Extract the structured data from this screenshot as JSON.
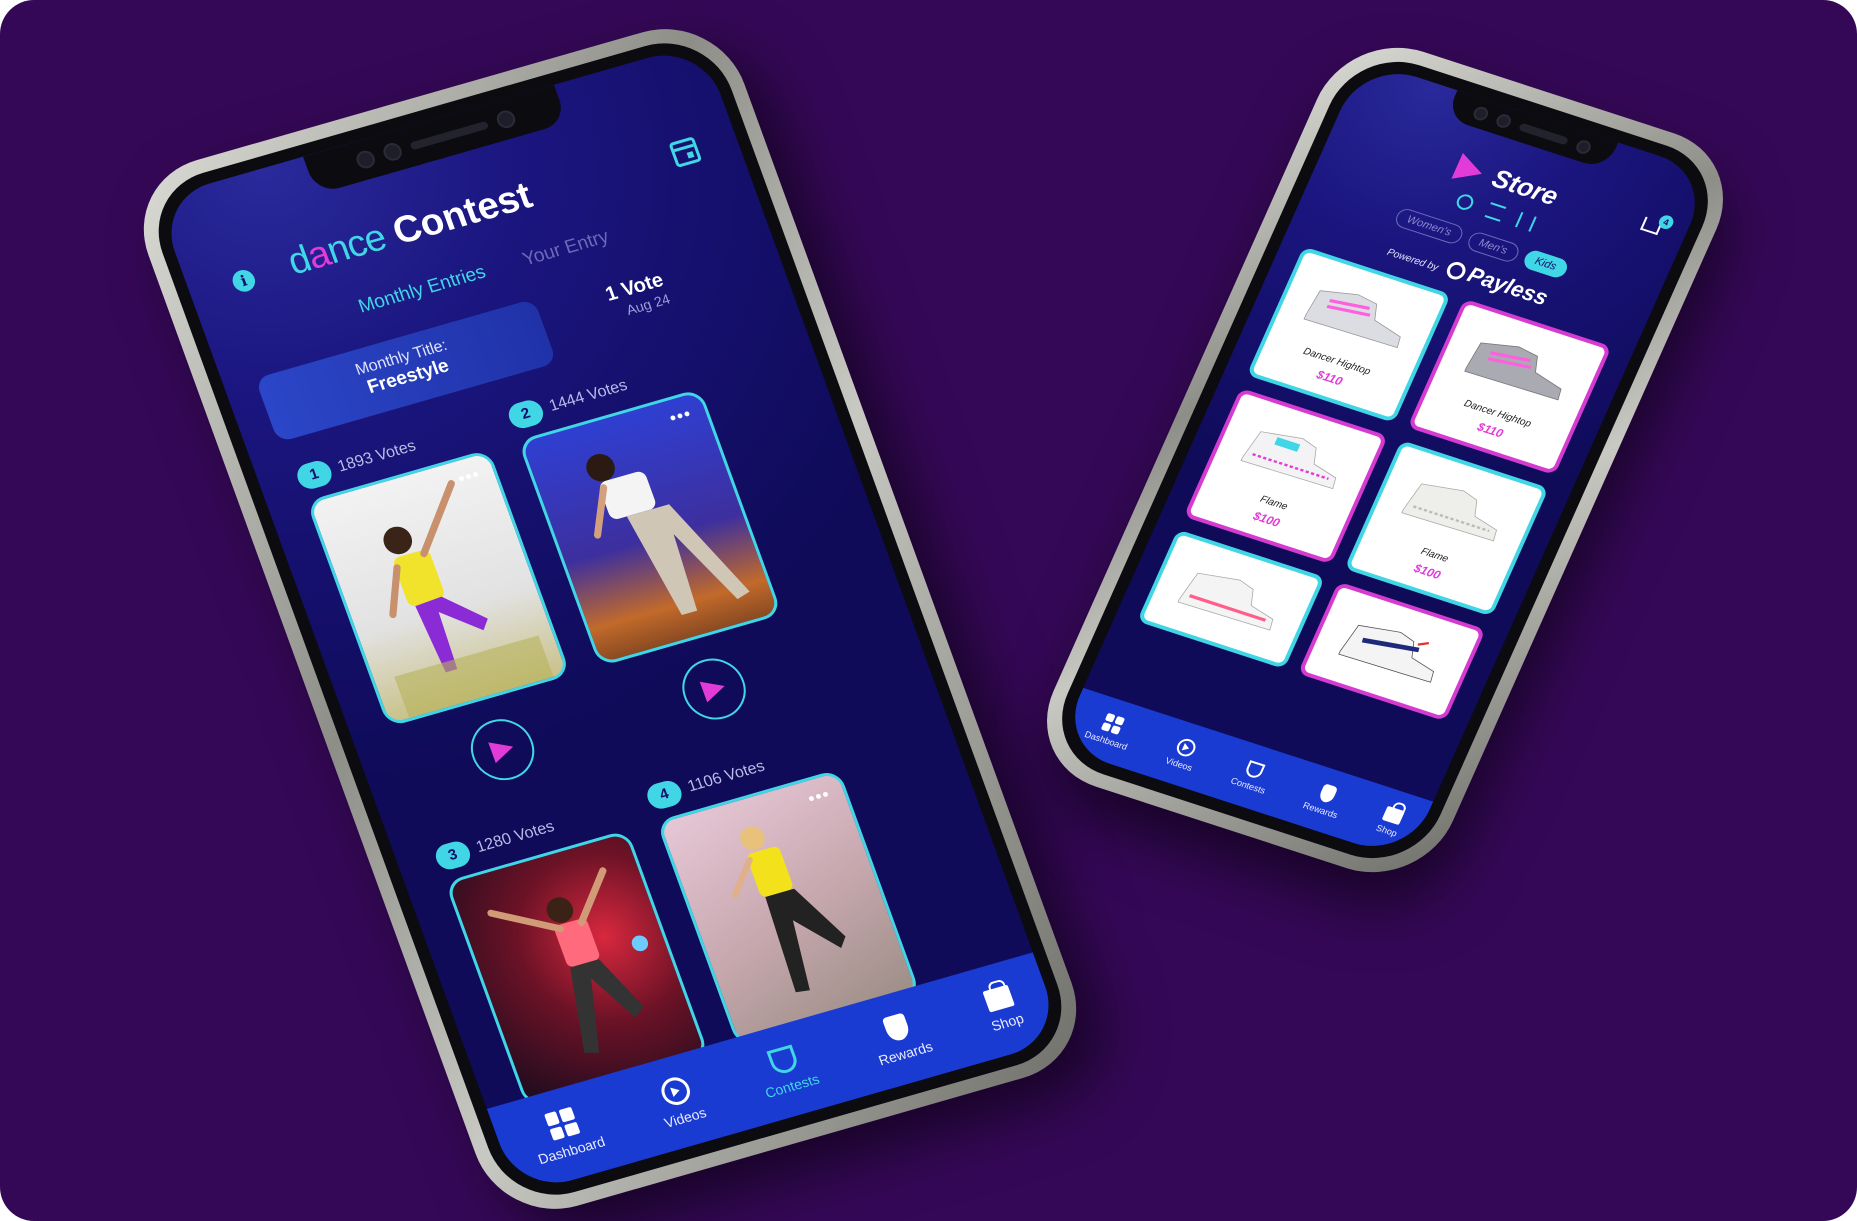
{
  "contest": {
    "brand_prefix": "d",
    "brand_accent": "a",
    "brand_suffix": "nce",
    "title": "Contest",
    "info_icon": "i",
    "tabs": [
      "Monthly Entries",
      "Your Entry"
    ],
    "banner": {
      "label": "Monthly Title:",
      "value": "Freestyle"
    },
    "vote": {
      "count": "1 Vote",
      "date": "Aug 24"
    },
    "more": "•••",
    "entries": [
      {
        "rank": "1",
        "votes": "1893 Votes"
      },
      {
        "rank": "2",
        "votes": "1444 Votes"
      },
      {
        "rank": "3",
        "votes": "1280 Votes"
      },
      {
        "rank": "4",
        "votes": "1106 Votes"
      }
    ],
    "nav": [
      "Dashboard",
      "Videos",
      "Contests",
      "Rewards",
      "Shop"
    ]
  },
  "store": {
    "title": "Store",
    "cart_count": "4",
    "chips": [
      "Women's",
      "Men's",
      "Kids"
    ],
    "active_chip": "Kids",
    "powered_by": "Powered by",
    "partner": "Payless",
    "products": [
      {
        "name": "Dancer Hightop",
        "price": "$110",
        "border": "cyan"
      },
      {
        "name": "Dancer Hightop",
        "price": "$110",
        "border": "pink"
      },
      {
        "name": "Flame",
        "price": "$100",
        "border": "pink"
      },
      {
        "name": "Flame",
        "price": "$100",
        "border": "cyan"
      },
      {
        "name": "",
        "price": "",
        "border": "cyan"
      },
      {
        "name": "",
        "price": "",
        "border": "pink"
      }
    ],
    "nav": [
      "Dashboard",
      "Videos",
      "Contests",
      "Rewards",
      "Shop"
    ]
  },
  "colors": {
    "background": "#350857",
    "accent_cyan": "#41d6e6",
    "accent_pink": "#e33bd8",
    "nav_blue": "#1a3bd1"
  }
}
